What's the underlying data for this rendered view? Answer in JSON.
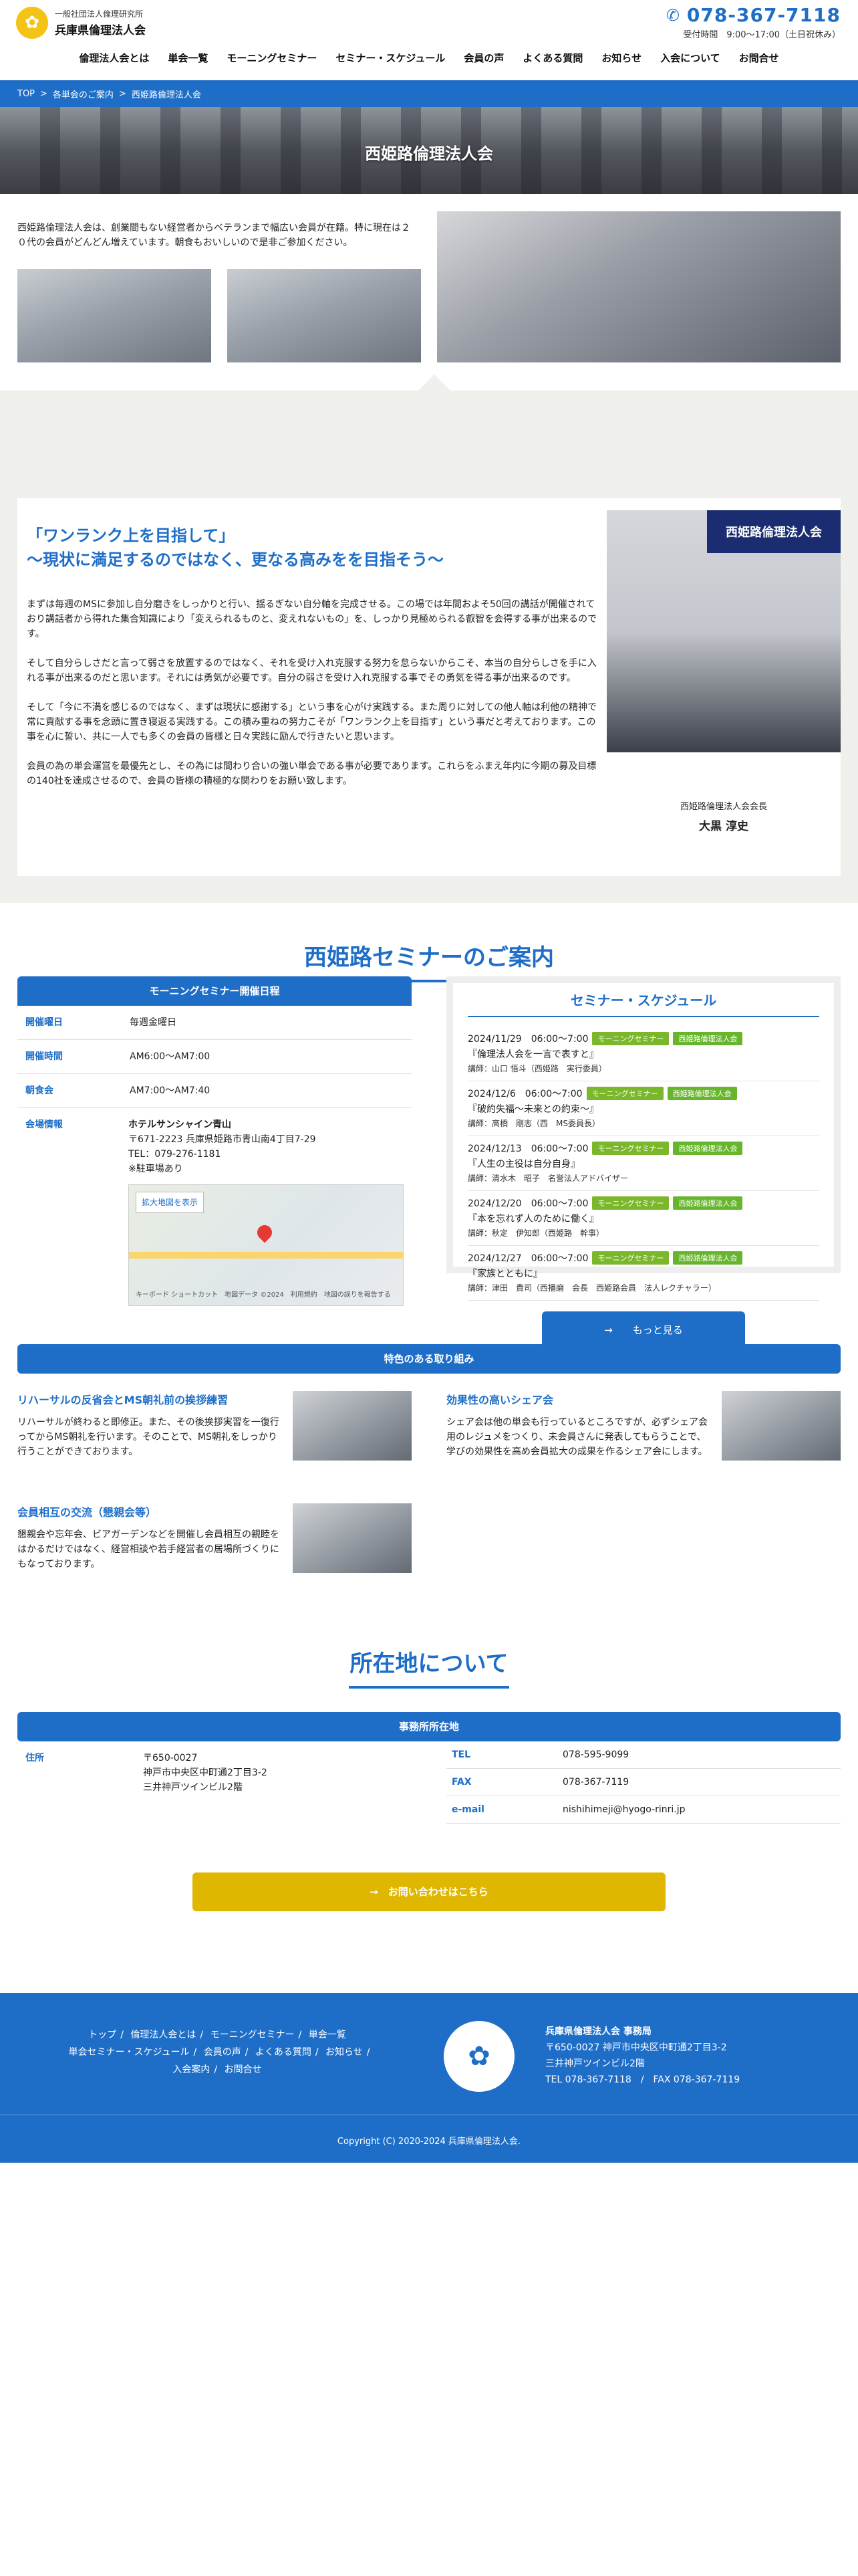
{
  "header": {
    "logo_sub": "一般社団法人倫理研究所",
    "logo_main": "兵庫県倫理法人会",
    "phone": "078-367-7118",
    "hours": "受付時間　9:00〜17:00（土日祝休み）"
  },
  "nav": [
    "倫理法人会とは",
    "単会一覧",
    "モーニングセミナー",
    "セミナー・スケジュール",
    "会員の声",
    "よくある質問",
    "お知らせ",
    "入会について",
    "お問合せ"
  ],
  "breadcrumb": [
    "TOP",
    ">",
    "各単会のご案内",
    ">",
    "西姫路倫理法人会"
  ],
  "hero_title": "西姫路倫理法人会",
  "intro_text": "西姫路倫理法人会は、創業間もない経営者からベテランまで幅広い会員が在籍。特に現在は２０代の会員がどんどん増えています。朝食もおいしいので是非ご参加ください。",
  "message": {
    "heading_1": "「ワンランク上を目指して」",
    "heading_2": "〜現状に満足するのではなく、更なる高みをを目指そう〜",
    "paragraphs": [
      "まずは毎週のMSに参加し自分磨きをしっかりと行い、揺るぎない自分軸を完成させる。この場では年間およそ50回の講話が開催されており講話者から得れた集合知識により「変えられるものと、変えれないもの」を、しっかり見極められる叡智を会得する事が出来るのです。",
      "そして自分らしさだと言って弱さを放置するのではなく、それを受け入れ克服する努力を怠らないからこそ、本当の自分らしさを手に入れる事が出来るのだと思います。それには勇気が必要です。自分の弱さを受け入れ克服する事でその勇気を得る事が出来るのです。",
      "そして「今に不満を感じるのではなく、まずは現状に感謝する」という事を心がけ実践する。また周りに対しての他人軸は利他の精神で常に貢献する事を念頭に置き寝返る実践する。この積み重ねの努力こそが「ワンランク上を目指す」という事だと考えております。この事を心に誓い、共に一人でも多くの会員の皆様と日々実践に励んで行きたいと思います。",
      "会員の為の単会運営を最優先とし、その為には間わり合いの強い単会である事が必要であります。これらをふまえ年内に今期の募及目標の140社を達成させるので、会員の皆様の積極的な関わりをお願い致します。"
    ],
    "banner": "西姫路倫理法人会",
    "role": "西姫路倫理法人会会長",
    "name": "大黒 淳史"
  },
  "seminar": {
    "title": "西姫路セミナーのご案内",
    "box_title": "モーニングセミナー開催日程",
    "rows": [
      {
        "key": "開催曜日",
        "val": "毎週金曜日"
      },
      {
        "key": "開催時間",
        "val": "AM6:00〜AM7:00"
      },
      {
        "key": "朝食会",
        "val": "AM7:00〜AM7:40"
      }
    ],
    "venue_key": "会場情報",
    "venue_name": "ホテルサンシャイン青山",
    "venue_addr": "〒671-2223 兵庫県姫路市青山南4丁目7-29",
    "venue_tel": "TEL：079-276-1181",
    "venue_note": "※駐車場あり",
    "map_btn": "拡大地図を表示",
    "map_foot": "キーボード ショートカット　地図データ ©2024　利用規約　地図の誤りを報告する"
  },
  "schedule": {
    "title": "セミナー・スケジュール",
    "badge_a": "モーニングセミナー",
    "badge_b": "西姫路倫理法人会",
    "events": [
      {
        "date": "2024/11/29　06:00〜7:00",
        "title": "『倫理法人会を一言で表すと』",
        "speaker": "講師：山口 悟斗（西姫路　実行委員）"
      },
      {
        "date": "2024/12/6　06:00〜7:00",
        "title": "『破約失福〜未来との約束〜』",
        "speaker": "講師：高橋　剛志（西　MS委員長）"
      },
      {
        "date": "2024/12/13　06:00〜7:00",
        "title": "『人生の主役は自分自身』",
        "speaker": "講師：清水木　昭子　名誉法人アドバイザー"
      },
      {
        "date": "2024/12/20　06:00〜7:00",
        "title": "『本を忘れず人のために働く』",
        "speaker": "講師：秋定　伊知郎（西姫路　幹事）"
      },
      {
        "date": "2024/12/27　06:00〜7:00",
        "title": "『家族とともに』",
        "speaker": "講師：津田　貴司（西播磨　会長　西姫路会員　法人レクチャラー）"
      }
    ],
    "more": "→　　もっと見る"
  },
  "features": {
    "title": "特色のある取り組み",
    "items": [
      {
        "title": "リハーサルの反省会とMS朝礼前の挨拶練習",
        "text": "リハーサルが終わると即修正。また、その後挨拶実習を一復行ってからMS朝礼を行います。そのことで、MS朝礼をしっかり行うことができております。"
      },
      {
        "title": "効果性の高いシェア会",
        "text": "シェア会は他の単会も行っているところですが、必ずシェア会用のレジュメをつくり、未会員さんに発表してもらうことで、学びの効果性を高め会員拡大の成果を作るシェア会にします。"
      },
      {
        "title": "会員相互の交流（懇親会等）",
        "text": "懇親会や忘年会、ビアガーデンなどを開催し会員相互の親睦をはかるだけではなく、経営相談や若手経営者の居場所づくりにもなっております。"
      }
    ]
  },
  "location": {
    "title": "所在地について",
    "box_title": "事務所所在地",
    "addr_key": "住所",
    "addr_lines": [
      "〒650-0027",
      "神戸市中央区中町通2丁目3-2",
      "三井神戸ツインビル2階"
    ],
    "rows": [
      {
        "key": "TEL",
        "val": "078-595-9099"
      },
      {
        "key": "FAX",
        "val": "078-367-7119"
      },
      {
        "key": "e-mail",
        "val": "nishihimeji@hyogo-rinri.jp"
      }
    ],
    "inquiry": "→　お問い合わせはこちら"
  },
  "footer": {
    "links_row1": [
      "トップ",
      "倫理法人会とは",
      "モーニングセミナー",
      "単会一覧"
    ],
    "links_row2": [
      "単会セミナー・スケジュール",
      "会員の声",
      "よくある質問",
      "お知らせ"
    ],
    "links_row3": [
      "入会案内",
      "お問合せ"
    ],
    "org": "兵庫県倫理法人会 事務局",
    "addr": "〒650-0027 神戸市中央区中町通2丁目3-2",
    "bldg": "三井神戸ツインビル2階",
    "telfax": "TEL 078-367-7118　/　FAX 078-367-7119",
    "copyright": "Copyright (C) 2020-2024 兵庫県倫理法人会."
  }
}
